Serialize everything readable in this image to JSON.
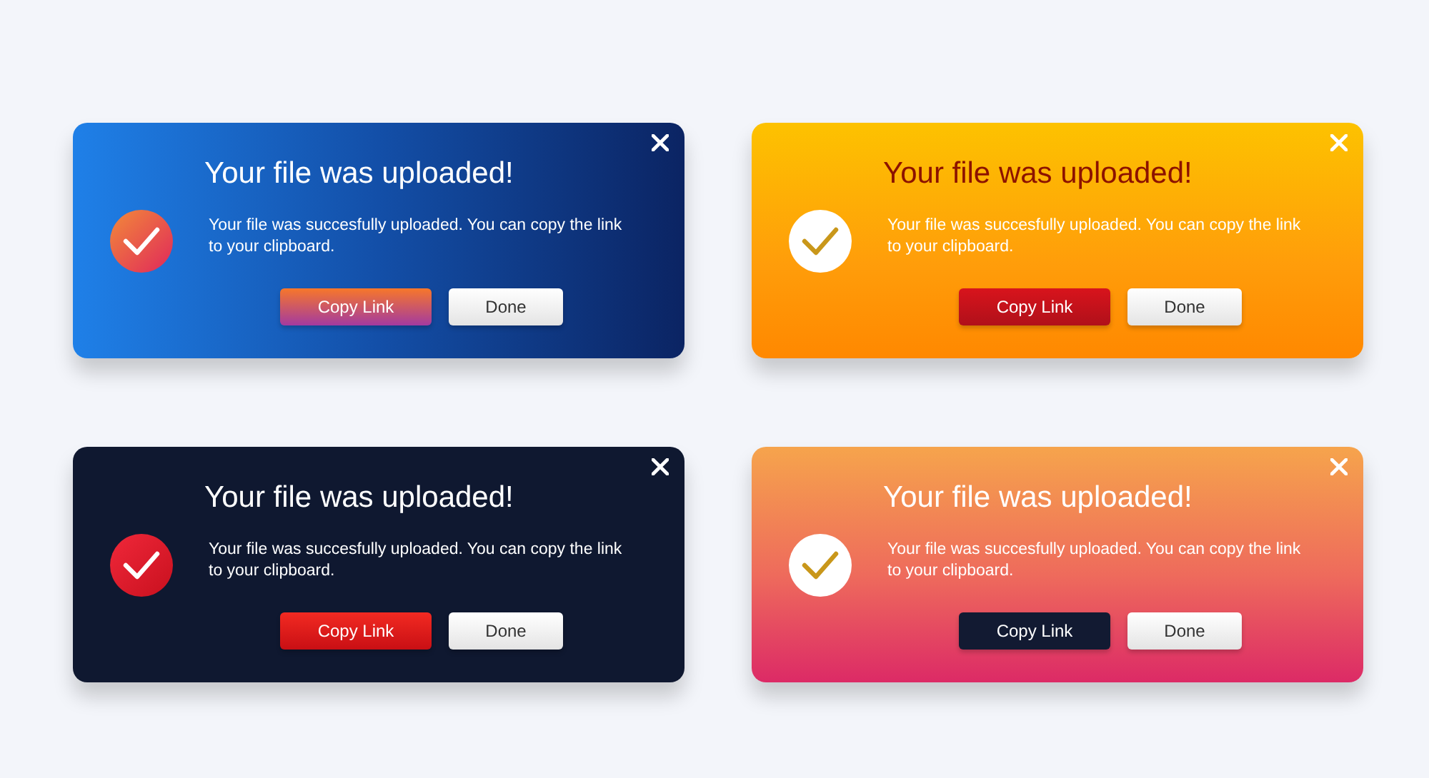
{
  "dialogs": [
    {
      "kind": "blue",
      "title": "Your file was uploaded!",
      "message": "Your file was succesfully uploaded. You can copy the link to your clipboard.",
      "copy_button": "Copy Link",
      "done_button": "Done"
    },
    {
      "kind": "amber",
      "title": "Your file was uploaded!",
      "message": "Your file was succesfully uploaded. You can copy the link to your clipboard.",
      "copy_button": "Copy Link",
      "done_button": "Done"
    },
    {
      "kind": "dark",
      "title": "Your file was uploaded!",
      "message": "Your file was succesfully uploaded. You can copy the link to your clipboard.",
      "copy_button": "Copy Link",
      "done_button": "Done"
    },
    {
      "kind": "sunset",
      "title": "Your file was uploaded!",
      "message": "Your file was succesfully uploaded. You can copy the link to your clipboard.",
      "copy_button": "Copy Link",
      "done_button": "Done"
    }
  ]
}
